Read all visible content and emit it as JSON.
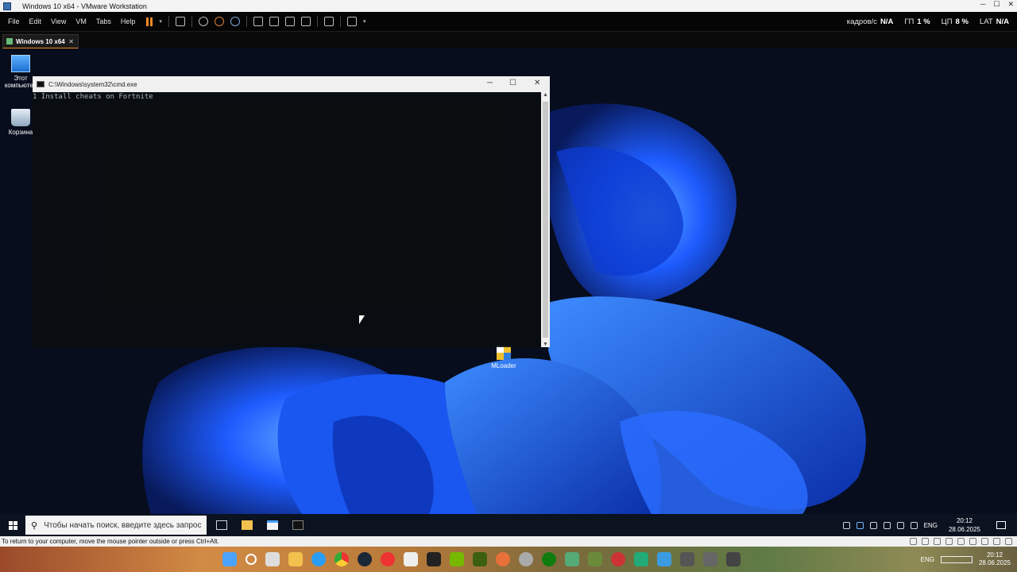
{
  "vmware": {
    "window_title": "Windows 10 x64 - VMware Workstation",
    "menu": [
      "File",
      "Edit",
      "View",
      "VM",
      "Tabs",
      "Help"
    ],
    "perf": [
      {
        "label": "кадров/с",
        "value": "N/A"
      },
      {
        "label": "ГП",
        "value": "1 %"
      },
      {
        "label": "ЦП",
        "value": "8 %"
      },
      {
        "label": "LAT",
        "value": "N/A"
      }
    ],
    "tab_label": "Windows 10 x64",
    "tab_close": "✕",
    "status_text": "To return to your computer, move the mouse pointer outside or press Ctrl+Alt."
  },
  "desktop": {
    "icons": [
      {
        "label": "Этот компьютер",
        "icon": "computer-icon"
      },
      {
        "label": "Корзина",
        "icon": "recycle-bin-icon"
      },
      {
        "label": "MLoader",
        "icon": "mloader-icon"
      }
    ]
  },
  "cmd": {
    "title": "C:\\Windows\\system32\\cmd.exe",
    "minimize": "─",
    "maximize": "☐",
    "close": "✕",
    "lines": [
      "1 Install cheats on Fortnite"
    ]
  },
  "guest_taskbar": {
    "search_placeholder": "Чтобы начать поиск, введите здесь запрос",
    "lang": "ENG",
    "time": "20:12",
    "date": "28.06.2025"
  },
  "host_taskbar": {
    "lang": "ENG",
    "time": "20:12",
    "date": "28.06.2025"
  },
  "colors": {
    "accent": "#f08a24",
    "desktop_bg": "#070d1c",
    "bloom_blue": "#1e5cff"
  }
}
